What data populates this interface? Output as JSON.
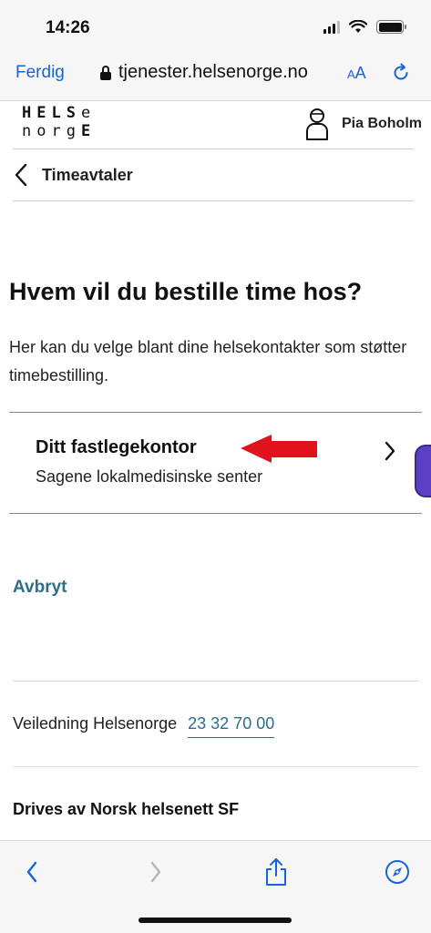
{
  "status": {
    "time": "14:26"
  },
  "browser": {
    "done_label": "Ferdig",
    "url": "tjenester.helsenorge.no",
    "text_size_label_small": "A",
    "text_size_label_large": "A"
  },
  "header": {
    "logo_line1": "HELSe",
    "logo_line2": "norgE",
    "user_name": "Pia Boholm"
  },
  "nav": {
    "back_label": "Timeavtaler"
  },
  "main": {
    "title": "Hvem vil du bestille time hos?",
    "intro": "Her kan du velge blant dine helsekontakter som støtter timebestilling.",
    "contacts": [
      {
        "title": "Ditt fastlegekontor",
        "subtitle": "Sagene lokalmedisinske senter"
      }
    ],
    "cancel_label": "Avbryt"
  },
  "footer": {
    "help_label": "Veiledning Helsenorge",
    "help_phone": "23 32 70 00",
    "operator": "Drives av Norsk helsenett SF"
  },
  "colors": {
    "link": "#2e6e87",
    "safari_blue": "#1a63d6",
    "annotation_arrow": "#e0121c",
    "side_tab": "#5b3fc4"
  }
}
